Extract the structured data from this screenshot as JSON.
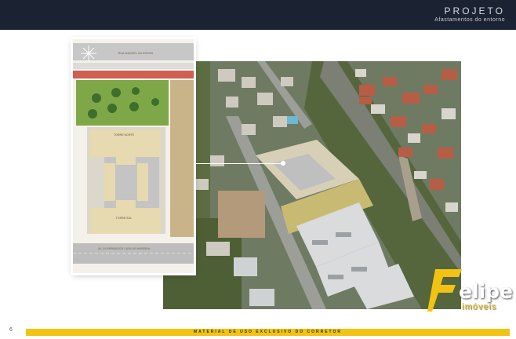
{
  "header": {
    "title": "PROJETO",
    "subtitle": "Afastamentos do entorno"
  },
  "plan": {
    "tower_north": "TORRE NORTE",
    "tower_south": "TORRE SUL",
    "street_top": "RUA MANOEL DA ROCHA",
    "street_bottom": "AV. GOVERNADOR CARLOS MOREIRA",
    "colors": {
      "lawn": "#7ea847",
      "road": "#bdbdbd",
      "bike_lane": "#c9584e",
      "tower": "#e7d9b0",
      "podium": "#c4c4c4",
      "side_lot": "#c9b48a"
    }
  },
  "footer": {
    "text": "MATERIAL DE USO EXCLUSIVO DO CORRETOR",
    "page_number": "6"
  },
  "logo": {
    "word": "elipe",
    "sub": "imóveis",
    "accent": "#f2c313"
  }
}
